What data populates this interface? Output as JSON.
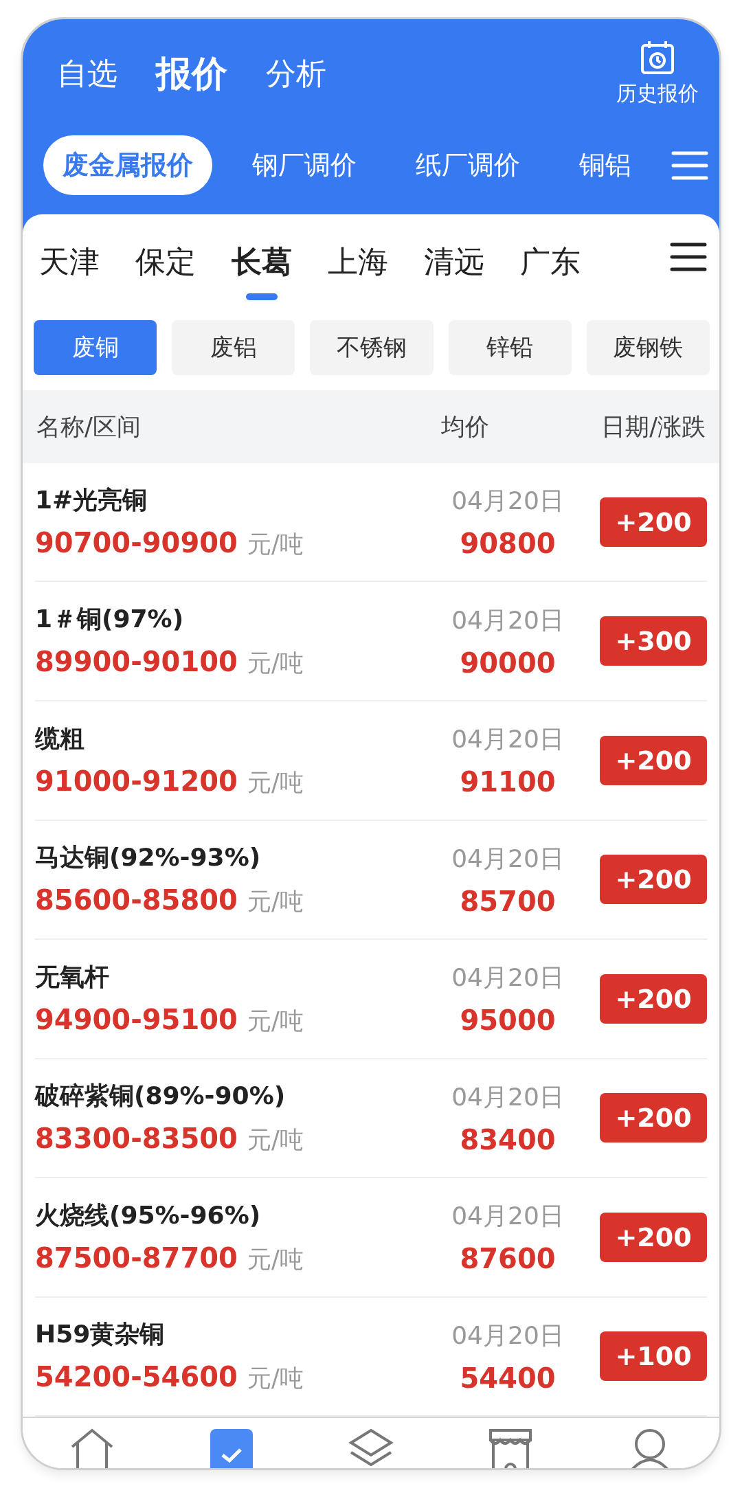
{
  "main_tabs": [
    {
      "label": "自选",
      "selected": false
    },
    {
      "label": "报价",
      "selected": true
    },
    {
      "label": "分析",
      "selected": false
    }
  ],
  "history_button": {
    "label": "历史报价"
  },
  "category_tabs": [
    {
      "label": "废金属报价",
      "selected": true
    },
    {
      "label": "钢厂调价",
      "selected": false
    },
    {
      "label": "纸厂调价",
      "selected": false
    },
    {
      "label": "铜铝",
      "selected": false
    }
  ],
  "city_tabs": [
    {
      "label": "天津",
      "selected": false
    },
    {
      "label": "保定",
      "selected": false
    },
    {
      "label": "长葛",
      "selected": true
    },
    {
      "label": "上海",
      "selected": false
    },
    {
      "label": "清远",
      "selected": false
    },
    {
      "label": "广东",
      "selected": false
    }
  ],
  "material_tabs": [
    {
      "label": "废铜",
      "selected": true
    },
    {
      "label": "废铝",
      "selected": false
    },
    {
      "label": "不锈钢",
      "selected": false
    },
    {
      "label": "锌铅",
      "selected": false
    },
    {
      "label": "废钢铁",
      "selected": false
    }
  ],
  "table": {
    "columns": [
      "名称/区间",
      "均价",
      "日期/涨跌"
    ],
    "rows": [
      {
        "name": "1#光亮铜",
        "range": "90700-90900",
        "unit": "元/吨",
        "date": "04月20日",
        "average": "90800",
        "change": "+200"
      },
      {
        "name": "1＃铜(97%)",
        "range": "89900-90100",
        "unit": "元/吨",
        "date": "04月20日",
        "average": "90000",
        "change": "+300"
      },
      {
        "name": "缆粗",
        "range": "91000-91200",
        "unit": "元/吨",
        "date": "04月20日",
        "average": "91100",
        "change": "+200"
      },
      {
        "name": "马达铜(92%-93%)",
        "range": "85600-85800",
        "unit": "元/吨",
        "date": "04月20日",
        "average": "85700",
        "change": "+200"
      },
      {
        "name": "无氧杆",
        "range": "94900-95100",
        "unit": "元/吨",
        "date": "04月20日",
        "average": "95000",
        "change": "+200"
      },
      {
        "name": "破碎紫铜(89%-90%)",
        "range": "83300-83500",
        "unit": "元/吨",
        "date": "04月20日",
        "average": "83400",
        "change": "+200"
      },
      {
        "name": "火烧线(95%-96%)",
        "range": "87500-87700",
        "unit": "元/吨",
        "date": "04月20日",
        "average": "87600",
        "change": "+200"
      },
      {
        "name": "H59黄杂铜",
        "range": "54200-54600",
        "unit": "元/吨",
        "date": "04月20日",
        "average": "54400",
        "change": "+100"
      }
    ]
  },
  "bottom_nav": [
    {
      "kind": "home",
      "selected": false
    },
    {
      "kind": "quote",
      "selected": true
    },
    {
      "kind": "layers",
      "selected": false
    },
    {
      "kind": "shop",
      "selected": false
    },
    {
      "kind": "profile",
      "selected": false
    }
  ]
}
